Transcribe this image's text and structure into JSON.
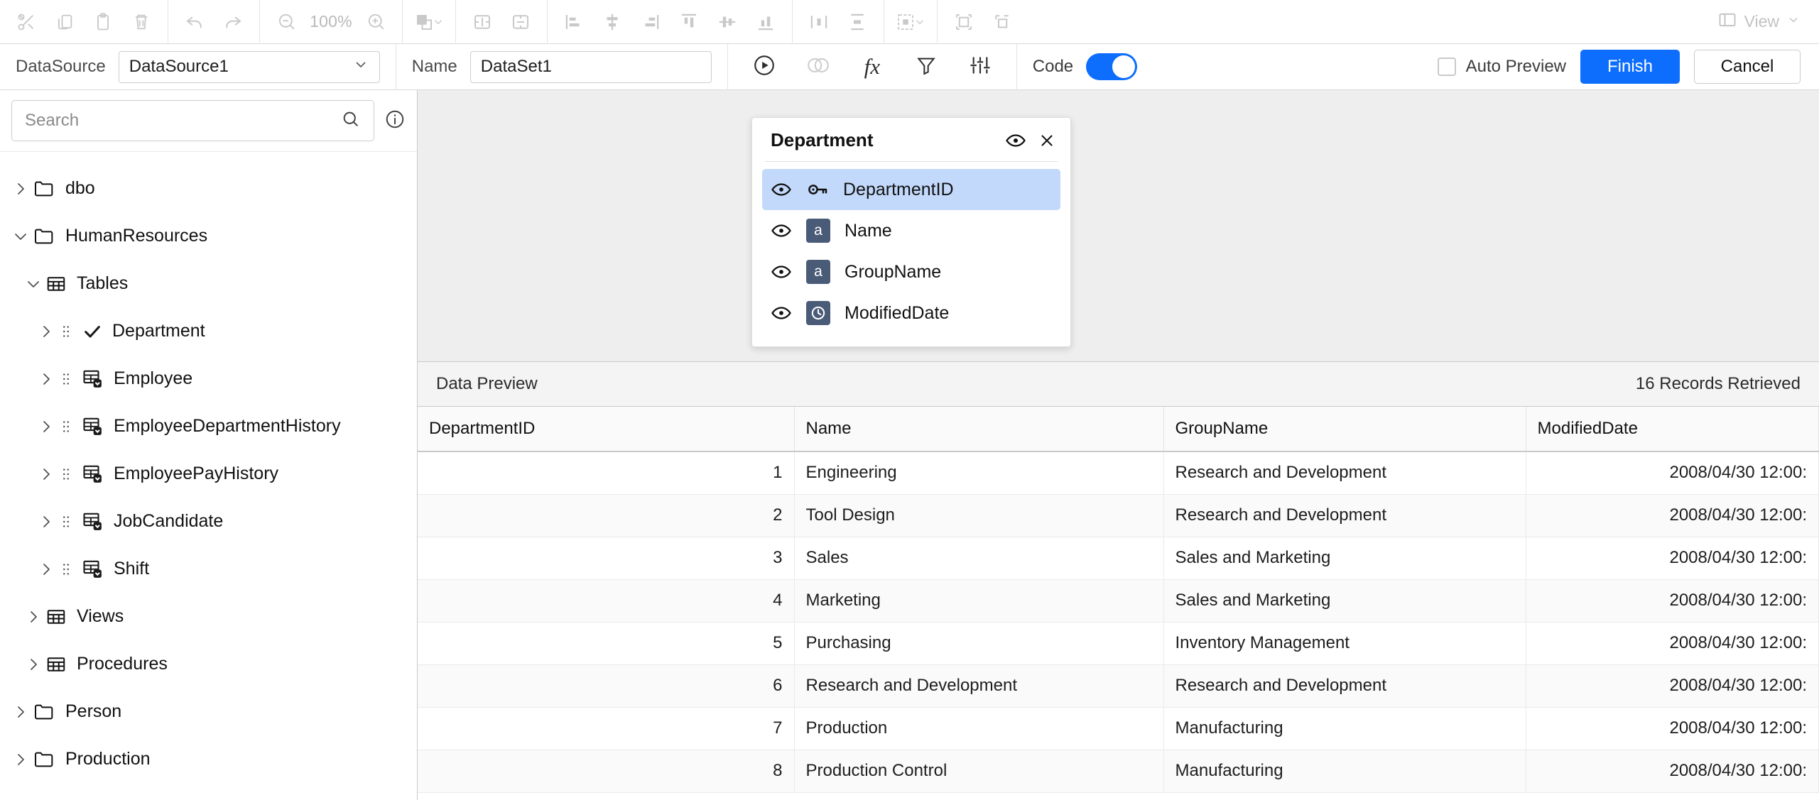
{
  "toolbar": {
    "zoom_level": "100%",
    "view_label": "View",
    "buttons": [
      {
        "name": "cut",
        "icon": "scissors-icon"
      },
      {
        "name": "copy",
        "icon": "copy-icon"
      },
      {
        "name": "paste",
        "icon": "paste-icon"
      },
      {
        "name": "delete",
        "icon": "trash-icon"
      },
      {
        "name": "undo",
        "icon": "undo-icon"
      },
      {
        "name": "redo",
        "icon": "redo-icon"
      },
      {
        "name": "zoom-out",
        "icon": "zoom-out-icon"
      },
      {
        "name": "zoom-in",
        "icon": "zoom-in-icon"
      },
      {
        "name": "arrange",
        "icon": "bring-to-front-icon"
      },
      {
        "name": "distribute-horizontal",
        "icon": "distribute-horizontal-icon"
      },
      {
        "name": "distribute-vertical",
        "icon": "distribute-vertical-icon"
      },
      {
        "name": "align-left",
        "icon": "align-left-icon"
      },
      {
        "name": "align-center",
        "icon": "align-center-icon"
      },
      {
        "name": "align-right",
        "icon": "align-right-icon"
      },
      {
        "name": "align-top",
        "icon": "align-top-icon"
      },
      {
        "name": "align-middle",
        "icon": "align-middle-icon"
      },
      {
        "name": "align-bottom",
        "icon": "align-bottom-icon"
      },
      {
        "name": "space-horizontal",
        "icon": "space-horizontal-icon"
      },
      {
        "name": "space-vertical",
        "icon": "space-vertical-icon"
      },
      {
        "name": "selection-mode",
        "icon": "selection-icon"
      },
      {
        "name": "group",
        "icon": "group-icon"
      },
      {
        "name": "ungroup",
        "icon": "ungroup-icon"
      }
    ]
  },
  "subbar": {
    "datasource_label": "DataSource",
    "datasource_value": "DataSource1",
    "name_label": "Name",
    "name_value": "DataSet1",
    "actions": [
      {
        "name": "run-query",
        "icon": "play-circle-icon"
      },
      {
        "name": "join",
        "icon": "join-icon"
      },
      {
        "name": "expression",
        "icon": "fx-icon"
      },
      {
        "name": "filter",
        "icon": "filter-icon"
      },
      {
        "name": "parameters",
        "icon": "sliders-icon"
      }
    ],
    "code_label": "Code",
    "code_enabled": true,
    "auto_preview_label": "Auto Preview",
    "auto_preview_checked": false,
    "finish_label": "Finish",
    "cancel_label": "Cancel",
    "accent_color": "#0d6efd"
  },
  "sidebar": {
    "search_placeholder": "Search",
    "search_value": "",
    "tree": [
      {
        "label": "dbo",
        "level": 0,
        "icon": "folder-icon",
        "expanded": false,
        "has_children": true,
        "grip": false
      },
      {
        "label": "HumanResources",
        "level": 0,
        "icon": "folder-icon",
        "expanded": true,
        "has_children": true,
        "grip": false
      },
      {
        "label": "Tables",
        "level": 1,
        "icon": "table-icon",
        "expanded": true,
        "has_children": true,
        "grip": false
      },
      {
        "label": "Department",
        "level": 2,
        "icon": "check-icon",
        "expanded": false,
        "has_children": true,
        "grip": true
      },
      {
        "label": "Employee",
        "level": 2,
        "icon": "table-add-icon",
        "expanded": false,
        "has_children": true,
        "grip": true
      },
      {
        "label": "EmployeeDepartmentHistory",
        "level": 2,
        "icon": "table-add-icon",
        "expanded": false,
        "has_children": true,
        "grip": true
      },
      {
        "label": "EmployeePayHistory",
        "level": 2,
        "icon": "table-add-icon",
        "expanded": false,
        "has_children": true,
        "grip": true
      },
      {
        "label": "JobCandidate",
        "level": 2,
        "icon": "table-add-icon",
        "expanded": false,
        "has_children": true,
        "grip": true
      },
      {
        "label": "Shift",
        "level": 2,
        "icon": "table-add-icon",
        "expanded": false,
        "has_children": true,
        "grip": true
      },
      {
        "label": "Views",
        "level": 1,
        "icon": "table-icon",
        "expanded": false,
        "has_children": true,
        "grip": false
      },
      {
        "label": "Procedures",
        "level": 1,
        "icon": "table-icon",
        "expanded": false,
        "has_children": true,
        "grip": false
      },
      {
        "label": "Person",
        "level": 0,
        "icon": "folder-icon",
        "expanded": false,
        "has_children": true,
        "grip": false
      },
      {
        "label": "Production",
        "level": 0,
        "icon": "folder-icon",
        "expanded": false,
        "has_children": true,
        "grip": false
      }
    ]
  },
  "field_popup": {
    "title": "Department",
    "fields": [
      {
        "name": "DepartmentID",
        "type_badge": "key",
        "badge_text": "",
        "selected": true,
        "visible": true
      },
      {
        "name": "Name",
        "type_badge": "string",
        "badge_text": "a",
        "selected": false,
        "visible": true
      },
      {
        "name": "GroupName",
        "type_badge": "string",
        "badge_text": "a",
        "selected": false,
        "visible": true
      },
      {
        "name": "ModifiedDate",
        "type_badge": "datetime",
        "badge_text": "",
        "selected": false,
        "visible": true
      }
    ]
  },
  "data_preview": {
    "title": "Data Preview",
    "records_retrieved": "16 Records Retrieved",
    "columns": [
      "DepartmentID",
      "Name",
      "GroupName",
      "ModifiedDate"
    ],
    "rows": [
      [
        "1",
        "Engineering",
        "Research and Development",
        "2008/04/30 12:00:"
      ],
      [
        "2",
        "Tool Design",
        "Research and Development",
        "2008/04/30 12:00:"
      ],
      [
        "3",
        "Sales",
        "Sales and Marketing",
        "2008/04/30 12:00:"
      ],
      [
        "4",
        "Marketing",
        "Sales and Marketing",
        "2008/04/30 12:00:"
      ],
      [
        "5",
        "Purchasing",
        "Inventory Management",
        "2008/04/30 12:00:"
      ],
      [
        "6",
        "Research and Development",
        "Research and Development",
        "2008/04/30 12:00:"
      ],
      [
        "7",
        "Production",
        "Manufacturing",
        "2008/04/30 12:00:"
      ],
      [
        "8",
        "Production Control",
        "Manufacturing",
        "2008/04/30 12:00:"
      ]
    ]
  }
}
